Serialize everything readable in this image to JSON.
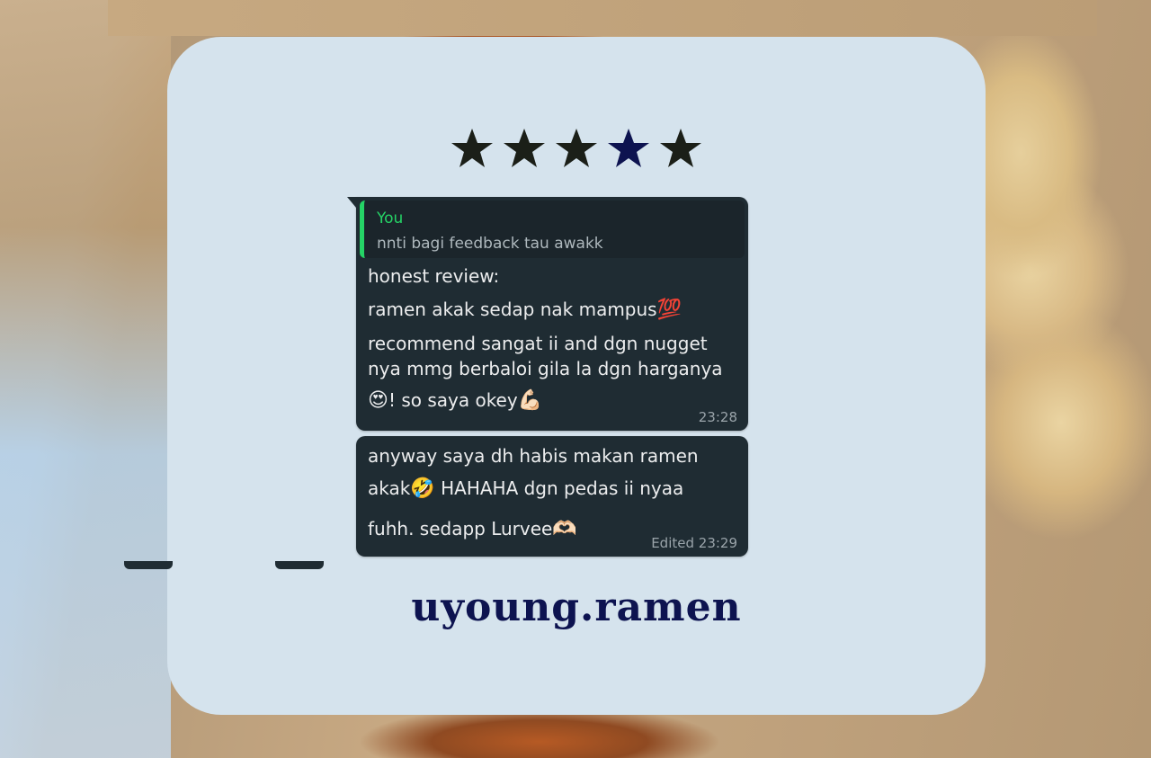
{
  "rating": {
    "stars": 5,
    "star_colors": [
      "#1b1f18",
      "#1b1f18",
      "#1b1f18",
      "#0d1350",
      "#1b1f18"
    ]
  },
  "chat": {
    "message_1": {
      "quote_author": "You",
      "quote_text": "nnti bagi feedback tau awakk",
      "lines": [
        "honest review:",
        "ramen akak sedap nak mampus",
        "recommend sangat ii and dgn nugget",
        "nya mmg berbaloi gila la dgn harganya",
        "! so saya okey"
      ],
      "emojis": {
        "hundred": "💯",
        "heart_eyes": "😍",
        "muscle": "💪🏻"
      },
      "time": "23:28"
    },
    "message_2": {
      "lines": [
        "anyway saya dh habis makan ramen",
        "HAHAHA dgn pedas ii nyaa",
        "fuhh. sedapp Lurvee"
      ],
      "line_2_prefix": "akak",
      "emojis": {
        "laughing": "🤣",
        "heart_hands": "🫶🏻"
      },
      "time": "Edited 23:29"
    }
  },
  "brand": {
    "name": "uyoung.ramen"
  },
  "colors": {
    "card": "#d5e3ed",
    "bubble": "#1f2c33",
    "quote_accent": "#25d366",
    "brand": "#0d1350"
  }
}
